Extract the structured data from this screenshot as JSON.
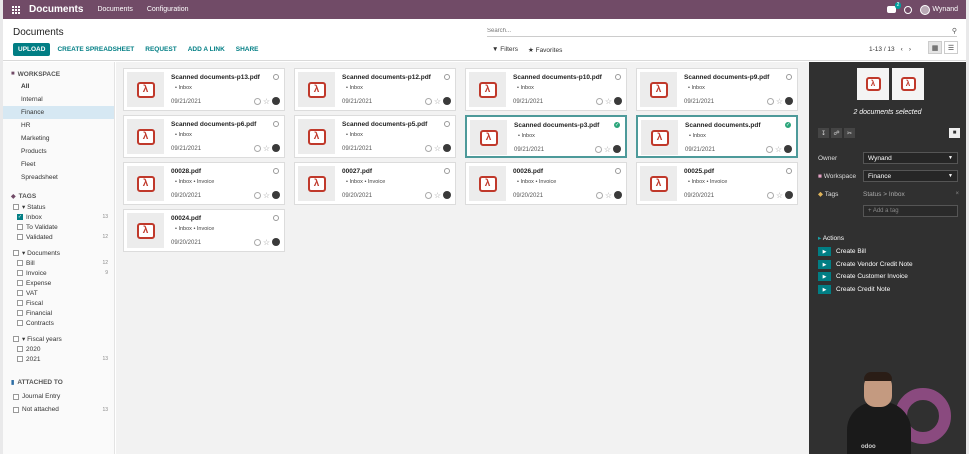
{
  "navbar": {
    "app_name": "Documents",
    "menu": [
      "Documents",
      "Configuration"
    ],
    "chat_badge": "2",
    "user": "Wynand"
  },
  "control": {
    "title": "Documents",
    "search_placeholder": "Search...",
    "buttons": {
      "upload": "UPLOAD",
      "create_spreadsheet": "CREATE SPREADSHEET",
      "request": "REQUEST",
      "add_link": "ADD A LINK",
      "share": "SHARE"
    },
    "filters_label": "Filters",
    "favorites_label": "Favorites",
    "pager": "1-13 / 13"
  },
  "sidebar": {
    "workspace_head": "WORKSPACE",
    "workspaces": [
      "All",
      "Internal",
      "Finance",
      "HR",
      "Marketing",
      "Products",
      "Fleet",
      "Spreadsheet"
    ],
    "selected_workspace": "Finance",
    "tags_head": "TAGS",
    "status_group": "Status",
    "status_items": [
      {
        "label": "Inbox",
        "count": "13",
        "checked": true
      },
      {
        "label": "To Validate",
        "count": "",
        "checked": false
      },
      {
        "label": "Validated",
        "count": "12",
        "checked": false
      }
    ],
    "documents_group": "Documents",
    "document_items": [
      {
        "label": "Bill",
        "count": "12"
      },
      {
        "label": "Invoice",
        "count": "9"
      },
      {
        "label": "Expense",
        "count": ""
      },
      {
        "label": "VAT",
        "count": ""
      },
      {
        "label": "Fiscal",
        "count": ""
      },
      {
        "label": "Financial",
        "count": ""
      },
      {
        "label": "Contracts",
        "count": ""
      }
    ],
    "fiscal_group": "Fiscal years",
    "fiscal_items": [
      {
        "label": "2020",
        "count": ""
      },
      {
        "label": "2021",
        "count": "13"
      }
    ],
    "attached_head": "ATTACHED TO",
    "attached_items": [
      {
        "label": "Journal Entry",
        "count": ""
      },
      {
        "label": "Not attached",
        "count": "13"
      }
    ]
  },
  "cards": [
    {
      "name": "Scanned documents-p13.pdf",
      "tags": "Inbox",
      "date": "09/21/2021",
      "selected": false
    },
    {
      "name": "Scanned documents-p12.pdf",
      "tags": "Inbox",
      "date": "09/21/2021",
      "selected": false
    },
    {
      "name": "Scanned documents-p10.pdf",
      "tags": "Inbox",
      "date": "09/21/2021",
      "selected": false
    },
    {
      "name": "Scanned documents-p9.pdf",
      "tags": "Inbox",
      "date": "09/21/2021",
      "selected": false
    },
    {
      "name": "Scanned documents-p6.pdf",
      "tags": "Inbox",
      "date": "09/21/2021",
      "selected": false
    },
    {
      "name": "Scanned documents-p5.pdf",
      "tags": "Inbox",
      "date": "09/21/2021",
      "selected": false
    },
    {
      "name": "Scanned documents-p3.pdf",
      "tags": "Inbox",
      "date": "09/21/2021",
      "selected": true
    },
    {
      "name": "Scanned documents.pdf",
      "tags": "Inbox",
      "date": "09/21/2021",
      "selected": true
    },
    {
      "name": "00028.pdf",
      "tags": "Inbox • Invoice",
      "date": "09/20/2021",
      "selected": false
    },
    {
      "name": "00027.pdf",
      "tags": "Inbox • Invoice",
      "date": "09/20/2021",
      "selected": false
    },
    {
      "name": "00026.pdf",
      "tags": "Inbox • Invoice",
      "date": "09/20/2021",
      "selected": false
    },
    {
      "name": "00025.pdf",
      "tags": "Inbox • Invoice",
      "date": "09/20/2021",
      "selected": false
    },
    {
      "name": "00024.pdf",
      "tags": "Inbox • Invoice",
      "date": "09/20/2021",
      "selected": false
    }
  ],
  "inspector": {
    "selected_text": "2 documents selected",
    "owner_label": "Owner",
    "owner_value": "Wynand",
    "workspace_label": "Workspace",
    "workspace_value": "Finance",
    "tags_label": "Tags",
    "tags_value": "Status > Inbox",
    "add_tag_placeholder": "+ Add a tag",
    "actions_head": "Actions",
    "actions": [
      "Create Bill",
      "Create Vendor Credit Note",
      "Create Customer Invoice",
      "Create Credit Note"
    ]
  },
  "webcam": {
    "logo": "odoo"
  },
  "colors": {
    "brand": "#714b67",
    "accent": "#017e84",
    "selected_border": "#4d9a9a",
    "panel": "#303030"
  }
}
